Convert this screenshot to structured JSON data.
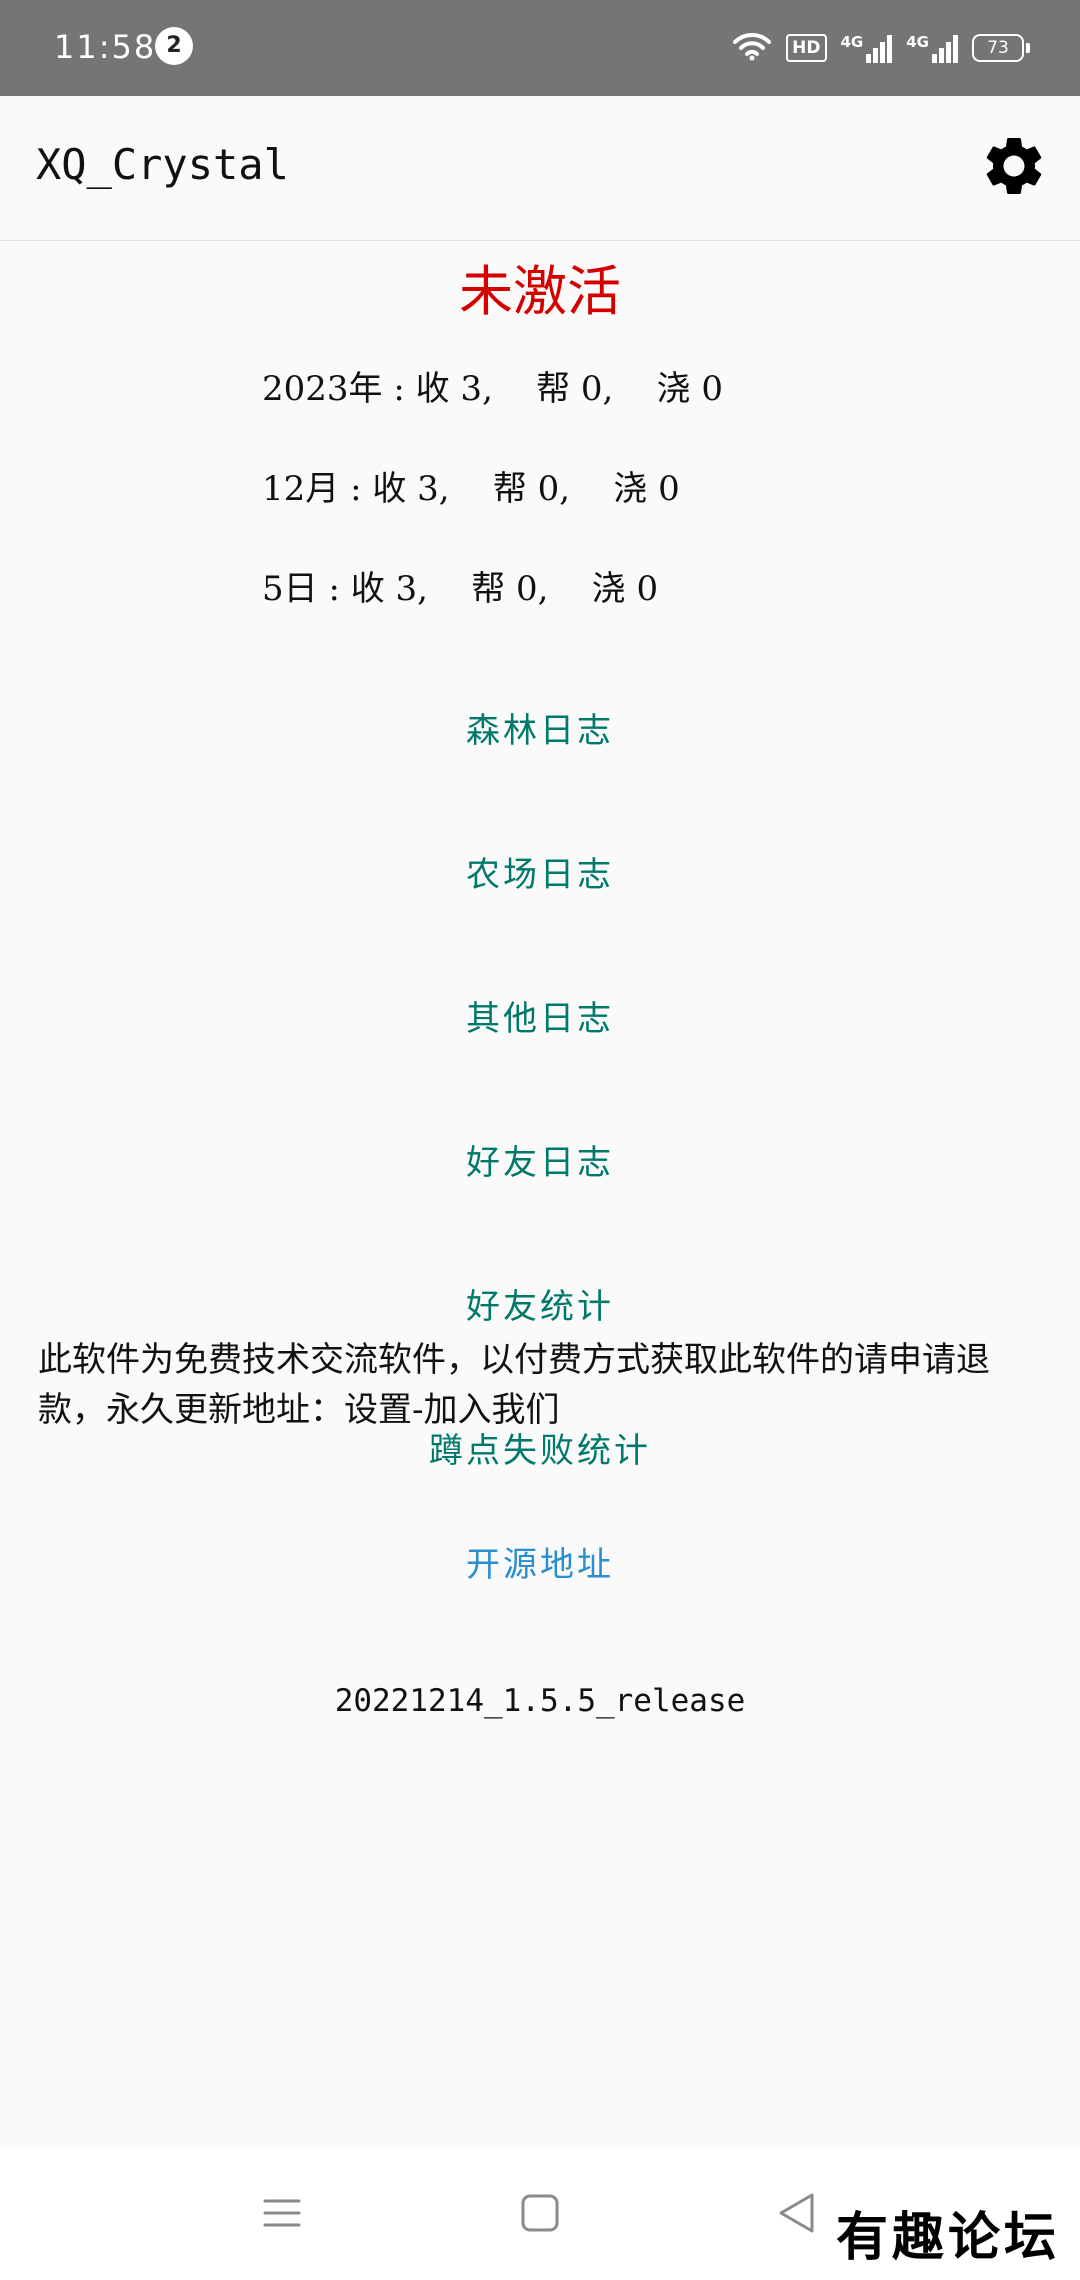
{
  "status_bar": {
    "time": "11:58",
    "notification_count": "2",
    "hd_label": "HD",
    "network_1": "4G",
    "network_2": "4G",
    "battery": "73"
  },
  "app_bar": {
    "title": "XQ_Crystal",
    "settings_icon": "gear-icon"
  },
  "main": {
    "activation_status": "未激活",
    "activation_color": "#d40000",
    "stats": [
      {
        "label": "2023年",
        "collect": "收 3,",
        "help": "帮 0,",
        "water": "浇 0"
      },
      {
        "label": "12月",
        "collect": "收 3,",
        "help": "帮 0,",
        "water": "浇 0"
      },
      {
        "label": "5日",
        "collect": "收 3,",
        "help": "帮 0,",
        "water": "浇 0"
      }
    ],
    "stat_separator": ":",
    "log_links": [
      {
        "label": "森林日志"
      },
      {
        "label": "农场日志"
      },
      {
        "label": "其他日志"
      },
      {
        "label": "好友日志"
      },
      {
        "label": "好友统计"
      },
      {
        "label": "蹲点失败统计"
      }
    ],
    "link_color": "#00796b",
    "notice": "此软件为免费技术交流软件，以付费方式获取此软件的请申请退款，永久更新地址：设置-加入我们",
    "source_link": "开源地址",
    "source_link_color": "#2a8fd0",
    "version": "20221214_1.5.5_release"
  },
  "nav_bar": {
    "menu_icon": "menu-icon",
    "home_icon": "home-icon",
    "back_icon": "back-icon"
  },
  "watermark": "有趣论坛"
}
